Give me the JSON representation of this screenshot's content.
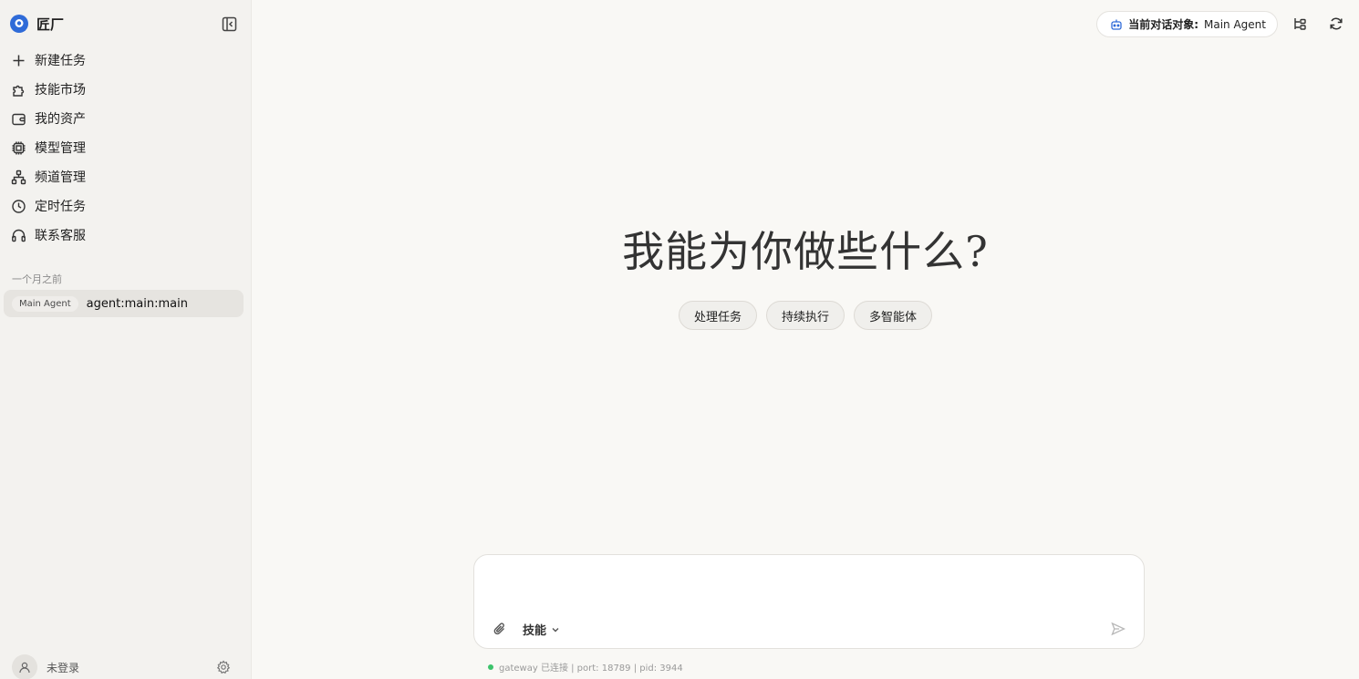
{
  "brand": {
    "name": "匠厂",
    "accent": "#2f6bd8"
  },
  "sidebar": {
    "nav": [
      {
        "label": "新建任务",
        "icon": "plus-icon"
      },
      {
        "label": "技能市场",
        "icon": "puzzle-icon"
      },
      {
        "label": "我的资产",
        "icon": "wallet-icon"
      },
      {
        "label": "模型管理",
        "icon": "chip-icon"
      },
      {
        "label": "频道管理",
        "icon": "network-icon"
      },
      {
        "label": "定时任务",
        "icon": "clock-icon"
      },
      {
        "label": "联系客服",
        "icon": "headset-icon"
      }
    ],
    "section_label": "一个月之前",
    "sessions": [
      {
        "badge": "Main Agent",
        "title": "agent:main:main"
      }
    ],
    "user": {
      "name": "未登录"
    }
  },
  "header": {
    "agent_label": "当前对话对象:",
    "agent_name": "Main Agent"
  },
  "main": {
    "hero": "我能为你做些什么?",
    "chips": [
      "处理任务",
      "持续执行",
      "多智能体"
    ]
  },
  "composer": {
    "placeholder": "",
    "skill_label": "技能"
  },
  "status": {
    "text": "gateway 已连接 | port: 18789 | pid: 3944",
    "dot_color": "#3cc36b"
  }
}
